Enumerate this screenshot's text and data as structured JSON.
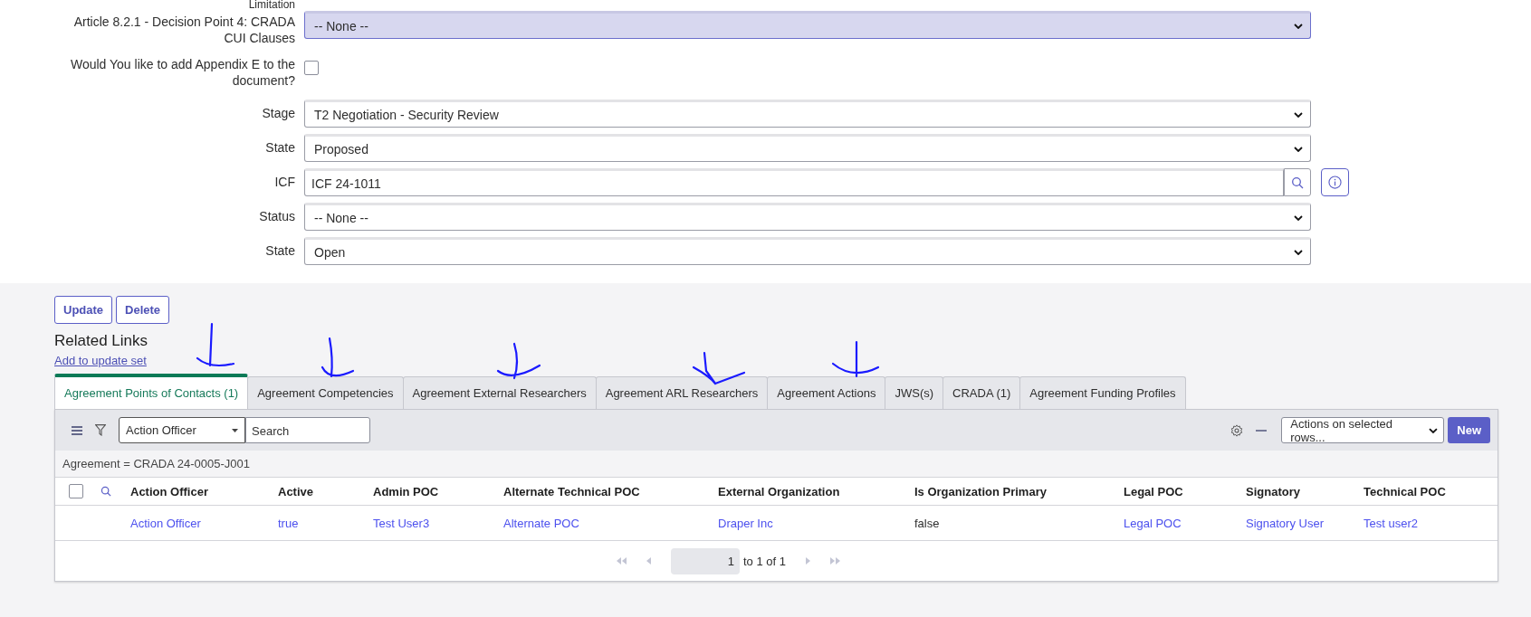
{
  "form": {
    "top_label": "Limitation",
    "fields": [
      {
        "kind": "select",
        "label": "Article 8.2.1 - Decision Point 4: CRADA CUI Clauses",
        "value": "-- None --",
        "highlighted": true
      },
      {
        "kind": "checkbox",
        "label": "Would You like to add Appendix E to the document?",
        "checked": false
      },
      {
        "kind": "select",
        "label": "Stage",
        "value": "T2 Negotiation - Security Review",
        "highlighted": false
      },
      {
        "kind": "select",
        "label": "State",
        "value": "Proposed",
        "highlighted": false
      },
      {
        "kind": "lookup",
        "label": "ICF",
        "value": "ICF 24-1011"
      },
      {
        "kind": "select",
        "label": "Status",
        "value": "-- None --",
        "highlighted": false
      },
      {
        "kind": "select",
        "label": "State",
        "value": "Open",
        "highlighted": false
      }
    ]
  },
  "buttons": [
    "Update",
    "Delete"
  ],
  "related_links": {
    "title": "Related Links",
    "links": [
      "Add to update set"
    ]
  },
  "tabs": [
    {
      "label": "Agreement Points of Contacts (1)",
      "selected": true
    },
    {
      "label": "Agreement Competencies",
      "selected": false
    },
    {
      "label": "Agreement External Researchers",
      "selected": false
    },
    {
      "label": "Agreement ARL Researchers",
      "selected": false
    },
    {
      "label": "Agreement Actions",
      "selected": false
    },
    {
      "label": "JWS(s)",
      "selected": false
    },
    {
      "label": "CRADA (1)",
      "selected": false
    },
    {
      "label": "Agreement Funding Profiles",
      "selected": false
    }
  ],
  "list": {
    "filter_field": "Action Officer",
    "search_placeholder": "Search",
    "actions_select": "Actions on selected rows...",
    "new_button": "New",
    "breadcrumb": "Agreement = CRADA 24-0005-J001",
    "select_all_checked": false,
    "columns": [
      "Action Officer",
      "Active",
      "Admin POC",
      "Alternate Technical POC",
      "External Organization",
      "Is Organization Primary",
      "Legal POC",
      "Signatory",
      "Technical POC"
    ],
    "rows": [
      {
        "cells": [
          {
            "text": "Action Officer",
            "link": true
          },
          {
            "text": "true",
            "link": true
          },
          {
            "text": "Test User3",
            "link": true
          },
          {
            "text": "Alternate POC",
            "link": true
          },
          {
            "text": "Draper Inc",
            "link": true
          },
          {
            "text": "false",
            "link": false
          },
          {
            "text": "Legal POC",
            "link": true
          },
          {
            "text": "Signatory User",
            "link": true
          },
          {
            "text": "Test user2",
            "link": true
          }
        ]
      }
    ],
    "pagination": {
      "page": "1",
      "range": "to 1 of 1"
    }
  }
}
